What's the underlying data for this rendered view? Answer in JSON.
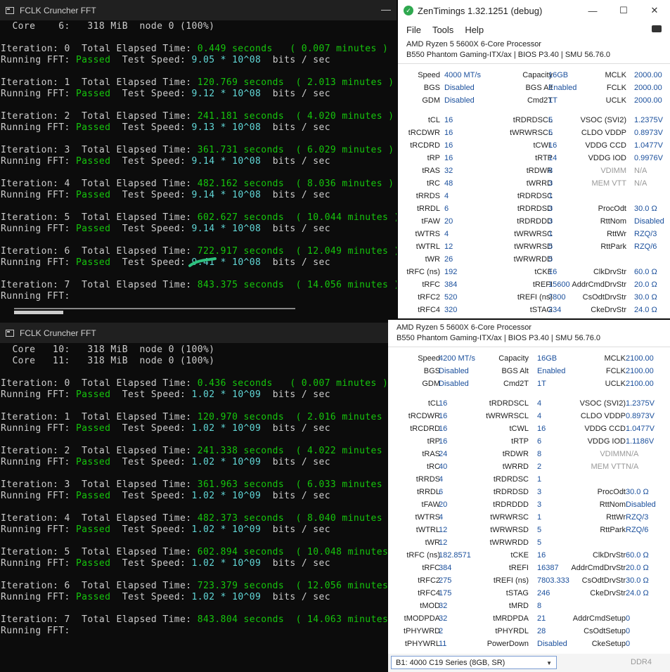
{
  "terminal_top": {
    "title": "FCLK Cruncher FFT",
    "lines": [
      [
        [
          "  Core    6:   ",
          ""
        ],
        [
          "318 MiB",
          ""
        ],
        [
          "  node 0 (100%)",
          ""
        ]
      ],
      [],
      [
        [
          "Iteration: 0  Total Elapsed Time: ",
          ""
        ],
        [
          "0.449 seconds   ( 0.007 minutes )",
          "g"
        ]
      ],
      [
        [
          "Running FFT: ",
          ""
        ],
        [
          "Passed",
          "g"
        ],
        [
          "  Test Speed: ",
          ""
        ],
        [
          "9.05 * 10^08",
          "c"
        ],
        [
          "  bits / sec",
          ""
        ]
      ],
      [],
      [
        [
          "Iteration: 1  Total Elapsed Time: ",
          ""
        ],
        [
          "120.769 seconds  ( 2.013 minutes )",
          "g"
        ]
      ],
      [
        [
          "Running FFT: ",
          ""
        ],
        [
          "Passed",
          "g"
        ],
        [
          "  Test Speed: ",
          ""
        ],
        [
          "9.12 * 10^08",
          "c"
        ],
        [
          "  bits / sec",
          ""
        ]
      ],
      [],
      [
        [
          "Iteration: 2  Total Elapsed Time: ",
          ""
        ],
        [
          "241.181 seconds  ( 4.020 minutes )",
          "g"
        ]
      ],
      [
        [
          "Running FFT: ",
          ""
        ],
        [
          "Passed",
          "g"
        ],
        [
          "  Test Speed: ",
          ""
        ],
        [
          "9.13 * 10^08",
          "c"
        ],
        [
          "  bits / sec",
          ""
        ]
      ],
      [],
      [
        [
          "Iteration: 3  Total Elapsed Time: ",
          ""
        ],
        [
          "361.731 seconds  ( 6.029 minutes )",
          "g"
        ]
      ],
      [
        [
          "Running FFT: ",
          ""
        ],
        [
          "Passed",
          "g"
        ],
        [
          "  Test Speed: ",
          ""
        ],
        [
          "9.14 * 10^08",
          "c"
        ],
        [
          "  bits / sec",
          ""
        ]
      ],
      [],
      [
        [
          "Iteration: 4  Total Elapsed Time: ",
          ""
        ],
        [
          "482.162 seconds  ( 8.036 minutes )",
          "g"
        ]
      ],
      [
        [
          "Running FFT: ",
          ""
        ],
        [
          "Passed",
          "g"
        ],
        [
          "  Test Speed: ",
          ""
        ],
        [
          "9.14 * 10^08",
          "c"
        ],
        [
          "  bits / sec",
          ""
        ]
      ],
      [],
      [
        [
          "Iteration: 5  Total Elapsed Time: ",
          ""
        ],
        [
          "602.627 seconds  ( 10.044 minutes )",
          "g"
        ]
      ],
      [
        [
          "Running FFT: ",
          ""
        ],
        [
          "Passed",
          "g"
        ],
        [
          "  Test Speed: ",
          ""
        ],
        [
          "9.14 * 10^08",
          "c"
        ],
        [
          "  bits / sec",
          ""
        ]
      ],
      [],
      [
        [
          "Iteration: 6  Total Elapsed Time: ",
          ""
        ],
        [
          "722.917 seconds  ( 12.049 minutes )",
          "g"
        ]
      ],
      [
        [
          "Running FFT: ",
          ""
        ],
        [
          "Passed",
          "g"
        ],
        [
          "  Test Speed: ",
          ""
        ],
        [
          "9.41 * 10^08",
          "c"
        ],
        [
          "  bits / sec",
          ""
        ]
      ],
      [],
      [
        [
          "Iteration: 7  Total Elapsed Time: ",
          ""
        ],
        [
          "843.375 seconds  ( 14.056 minutes )",
          "g"
        ]
      ],
      [
        [
          "Running FFT: ",
          ""
        ]
      ]
    ]
  },
  "terminal_bottom": {
    "title": "FCLK Cruncher FFT",
    "lines": [
      [
        [
          "  Core   10:   ",
          ""
        ],
        [
          "318 MiB",
          ""
        ],
        [
          "  node 0 (100%)",
          ""
        ]
      ],
      [
        [
          "  Core   11:   ",
          ""
        ],
        [
          "318 MiB",
          ""
        ],
        [
          "  node 0 (100%)",
          ""
        ]
      ],
      [],
      [
        [
          "Iteration: 0  Total Elapsed Time: ",
          ""
        ],
        [
          "0.436 seconds   ( 0.007 minutes )",
          "g"
        ]
      ],
      [
        [
          "Running FFT: ",
          ""
        ],
        [
          "Passed",
          "g"
        ],
        [
          "  Test Speed: ",
          ""
        ],
        [
          "1.02 * 10^09",
          "c"
        ],
        [
          "  bits / sec",
          ""
        ]
      ],
      [],
      [
        [
          "Iteration: 1  Total Elapsed Time: ",
          ""
        ],
        [
          "120.970 seconds  ( 2.016 minutes )",
          "g"
        ]
      ],
      [
        [
          "Running FFT: ",
          ""
        ],
        [
          "Passed",
          "g"
        ],
        [
          "  Test Speed: ",
          ""
        ],
        [
          "1.02 * 10^09",
          "c"
        ],
        [
          "  bits / sec",
          ""
        ]
      ],
      [],
      [
        [
          "Iteration: 2  Total Elapsed Time: ",
          ""
        ],
        [
          "241.338 seconds  ( 4.022 minutes )",
          "g"
        ]
      ],
      [
        [
          "Running FFT: ",
          ""
        ],
        [
          "Passed",
          "g"
        ],
        [
          "  Test Speed: ",
          ""
        ],
        [
          "1.02 * 10^09",
          "c"
        ],
        [
          "  bits / sec",
          ""
        ]
      ],
      [],
      [
        [
          "Iteration: 3  Total Elapsed Time: ",
          ""
        ],
        [
          "361.963 seconds  ( 6.033 minutes )",
          "g"
        ]
      ],
      [
        [
          "Running FFT: ",
          ""
        ],
        [
          "Passed",
          "g"
        ],
        [
          "  Test Speed: ",
          ""
        ],
        [
          "1.02 * 10^09",
          "c"
        ],
        [
          "  bits / sec",
          ""
        ]
      ],
      [],
      [
        [
          "Iteration: 4  Total Elapsed Time: ",
          ""
        ],
        [
          "482.373 seconds  ( 8.040 minutes )",
          "g"
        ]
      ],
      [
        [
          "Running FFT: ",
          ""
        ],
        [
          "Passed",
          "g"
        ],
        [
          "  Test Speed: ",
          ""
        ],
        [
          "1.02 * 10^09",
          "c"
        ],
        [
          "  bits / sec",
          ""
        ]
      ],
      [],
      [
        [
          "Iteration: 5  Total Elapsed Time: ",
          ""
        ],
        [
          "602.894 seconds  ( 10.048 minutes )",
          "g"
        ]
      ],
      [
        [
          "Running FFT: ",
          ""
        ],
        [
          "Passed",
          "g"
        ],
        [
          "  Test Speed: ",
          ""
        ],
        [
          "1.02 * 10^09",
          "c"
        ],
        [
          "  bits / sec",
          ""
        ]
      ],
      [],
      [
        [
          "Iteration: 6  Total Elapsed Time: ",
          ""
        ],
        [
          "723.379 seconds  ( 12.056 minutes )",
          "g"
        ]
      ],
      [
        [
          "Running FFT: ",
          ""
        ],
        [
          "Passed",
          "g"
        ],
        [
          "  Test Speed: ",
          ""
        ],
        [
          "1.02 * 10^09",
          "c"
        ],
        [
          "  bits / sec",
          ""
        ]
      ],
      [],
      [
        [
          "Iteration: 7  Total Elapsed Time: ",
          ""
        ],
        [
          "843.804 seconds  ( 14.063 minutes )",
          "g"
        ]
      ],
      [
        [
          "Running FFT: ",
          ""
        ]
      ]
    ]
  },
  "zen_top": {
    "title": "ZenTimings 1.32.1251 (debug)",
    "menu": [
      "File",
      "Tools",
      "Help"
    ],
    "cpu_name": "AMD Ryzen 5 5600X 6-Core Processor",
    "board": "B550 Phantom Gaming-ITX/ax | BIOS P3.40 | SMU 56.76.0",
    "groups": [
      [
        [
          "Speed",
          "4000 MT/s",
          "Capacity",
          "16GB",
          "MCLK",
          "2000.00"
        ],
        [
          "BGS",
          "Disabled",
          "BGS Alt",
          "Enabled",
          "FCLK",
          "2000.00"
        ],
        [
          "GDM",
          "Disabled",
          "Cmd2T",
          "1T",
          "UCLK",
          "2000.00"
        ]
      ],
      [
        [
          "tCL",
          "16",
          "tRDRDSCL",
          "5",
          "VSOC (SVI2)",
          "1.2375V"
        ],
        [
          "tRCDWR",
          "16",
          "tWRWRSCL",
          "5",
          "CLDO VDDP",
          "0.8973V"
        ],
        [
          "tRCDRD",
          "16",
          "tCWL",
          "16",
          "VDDG CCD",
          "1.0477V"
        ],
        [
          "tRP",
          "16",
          "tRTP",
          "14",
          "VDDG IOD",
          "0.9976V"
        ],
        [
          "tRAS",
          "32",
          "tRDWR",
          "8",
          "VDIMM",
          "N/A"
        ],
        [
          "tRC",
          "48",
          "tWRRD",
          "3",
          "MEM VTT",
          "N/A"
        ],
        [
          "tRRDS",
          "4",
          "tRDRDSC",
          "1",
          "",
          ""
        ],
        [
          "tRRDL",
          "6",
          "tRDRDSD",
          "3",
          "ProcOdt",
          "30.0 Ω"
        ],
        [
          "tFAW",
          "20",
          "tRDRDDD",
          "3",
          "RttNom",
          "Disabled"
        ],
        [
          "tWTRS",
          "4",
          "tWRWRSC",
          "1",
          "RttWr",
          "RZQ/3"
        ],
        [
          "tWTRL",
          "12",
          "tWRWRSD",
          "5",
          "RttPark",
          "RZQ/6"
        ],
        [
          "tWR",
          "26",
          "tWRWRDD",
          "5",
          "",
          ""
        ],
        [
          "tRFC (ns)",
          "192",
          "tCKE",
          "16",
          "ClkDrvStr",
          "60.0 Ω"
        ],
        [
          "tRFC",
          "384",
          "tREFI",
          "15600",
          "AddrCmdDrvStr",
          "20.0 Ω"
        ],
        [
          "tRFC2",
          "520",
          "tREFI (ns)",
          "7800",
          "CsOdtDrvStr",
          "30.0 Ω"
        ],
        [
          "tRFC4",
          "320",
          "tSTAG",
          "234",
          "CkeDrvStr",
          "24.0 Ω"
        ]
      ]
    ]
  },
  "zen_bottom": {
    "cpu_name": "AMD Ryzen 5 5600X 6-Core Processor",
    "board": "B550 Phantom Gaming-ITX/ax | BIOS P3.40 | SMU 56.76.0",
    "groups": [
      [
        [
          "Speed",
          "4200 MT/s",
          "Capacity",
          "16GB",
          "MCLK",
          "2100.00"
        ],
        [
          "BGS",
          "Disabled",
          "BGS Alt",
          "Enabled",
          "FCLK",
          "2100.00"
        ],
        [
          "GDM",
          "Disabled",
          "Cmd2T",
          "1T",
          "UCLK",
          "2100.00"
        ]
      ],
      [
        [
          "tCL",
          "16",
          "tRDRDSCL",
          "4",
          "VSOC (SVI2)",
          "1.2375V"
        ],
        [
          "tRCDWR",
          "16",
          "tWRWRSCL",
          "4",
          "CLDO VDDP",
          "0.8973V"
        ],
        [
          "tRCDRD",
          "16",
          "tCWL",
          "16",
          "VDDG CCD",
          "1.0477V"
        ],
        [
          "tRP",
          "16",
          "tRTP",
          "6",
          "VDDG IOD",
          "1.1186V"
        ],
        [
          "tRAS",
          "24",
          "tRDWR",
          "8",
          "VDIMM",
          "N/A"
        ],
        [
          "tRC",
          "40",
          "tWRRD",
          "2",
          "MEM VTT",
          "N/A"
        ],
        [
          "tRRDS",
          "4",
          "tRDRDSC",
          "1",
          "",
          ""
        ],
        [
          "tRRDL",
          "6",
          "tRDRDSD",
          "3",
          "ProcOdt",
          "30.0 Ω"
        ],
        [
          "tFAW",
          "20",
          "tRDRDDD",
          "3",
          "RttNom",
          "Disabled"
        ],
        [
          "tWTRS",
          "4",
          "tWRWRSC",
          "1",
          "RttWr",
          "RZQ/3"
        ],
        [
          "tWTRL",
          "12",
          "tWRWRSD",
          "5",
          "RttPark",
          "RZQ/6"
        ],
        [
          "tWR",
          "12",
          "tWRWRDD",
          "5",
          "",
          ""
        ],
        [
          "tRFC (ns)",
          "182.8571",
          "tCKE",
          "16",
          "ClkDrvStr",
          "60.0 Ω"
        ],
        [
          "tRFC",
          "384",
          "tREFI",
          "16387",
          "AddrCmdDrvStr",
          "20.0 Ω"
        ],
        [
          "tRFC2",
          "275",
          "tREFI (ns)",
          "7803.333",
          "CsOdtDrvStr",
          "30.0 Ω"
        ],
        [
          "tRFC4",
          "175",
          "tSTAG",
          "246",
          "CkeDrvStr",
          "24.0 Ω"
        ],
        [
          "tMOD",
          "32",
          "tMRD",
          "8",
          "",
          ""
        ],
        [
          "tMODPDA",
          "32",
          "tMRDPDA",
          "21",
          "AddrCmdSetup",
          "0"
        ],
        [
          "tPHYWRD",
          "2",
          "tPHYRDL",
          "28",
          "CsOdtSetup",
          "0"
        ],
        [
          "tPHYWRL",
          "11",
          "PowerDown",
          "Disabled",
          "CkeSetup",
          "0"
        ]
      ]
    ],
    "profile_select": "B1: 4000 C19 Series (8GB, SR)",
    "ddr_type": "DDR4"
  }
}
